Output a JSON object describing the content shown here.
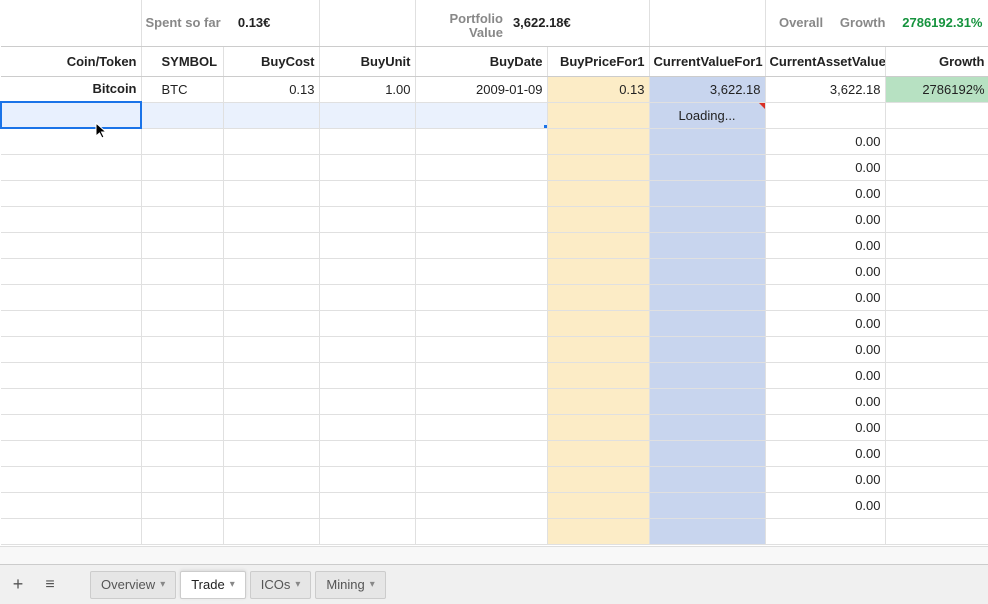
{
  "summary": {
    "spent_label": "Spent so far",
    "spent_value": "0.13€",
    "portfolio_label_line1": "Portfolio",
    "portfolio_label_line2": "Value",
    "portfolio_value": "3,622.18€",
    "overall_label": "Overall",
    "growth_label": "Growth",
    "growth_value": "2786192.31%"
  },
  "headers": {
    "coin": "Coin/Token",
    "symbol": "SYMBOL",
    "buycost": "BuyCost",
    "buyunit": "BuyUnit",
    "buydate": "BuyDate",
    "buyprice1": "BuyPriceFor1",
    "curval1": "CurrentValueFor1",
    "assetval": "CurrentAssetValue",
    "growth": "Growth"
  },
  "rows": [
    {
      "coin": "Bitcoin",
      "symbol": "BTC",
      "buycost": "0.13",
      "buyunit": "1.00",
      "buydate": "2009-01-09",
      "buyprice1": "0.13",
      "curval1": "3,622.18",
      "assetval": "3,622.18",
      "growth": "2786192%"
    }
  ],
  "loading_text": "Loading...",
  "zero_value": "0.00",
  "tabs": {
    "overview": "Overview",
    "trade": "Trade",
    "icos": "ICOs",
    "mining": "Mining"
  }
}
